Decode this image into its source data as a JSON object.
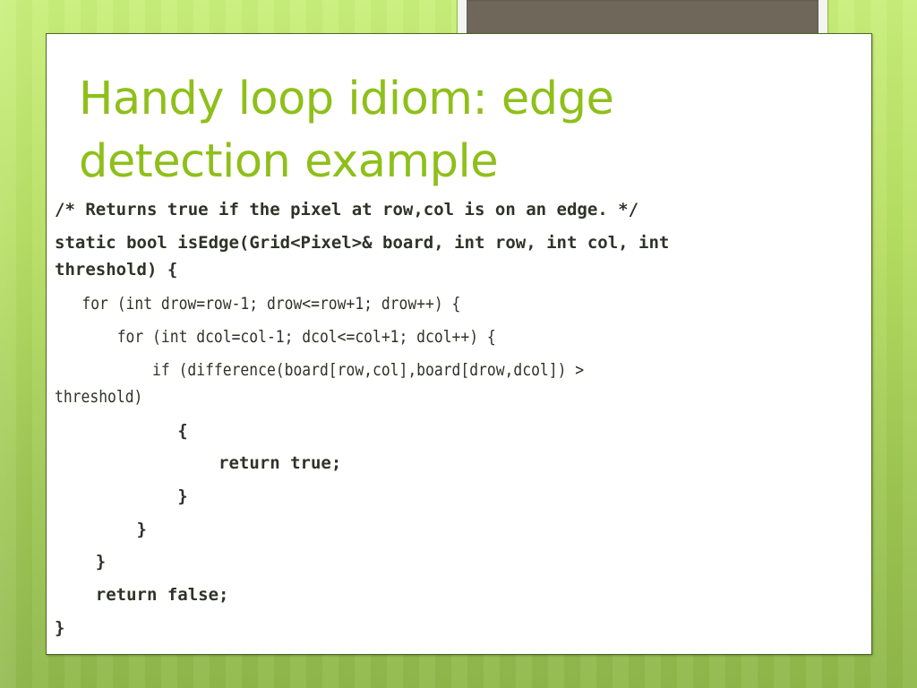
{
  "slide": {
    "title_lines": [
      "Handy loop idiom: edge",
      "detection example"
    ],
    "colors": {
      "title": "#8fbf1a",
      "code_text": "#2f3327",
      "background_green": "#b6de62",
      "photo_placeholder": "#6e675a",
      "frame_border": "#4e6a22"
    },
    "code_lines": [
      "/* Returns true if the pixel at row,col is on an edge. */",
      "static bool isEdge(Grid<Pixel>& board, int row, int col, int",
      "threshold) {",
      "    for (int drow=row-1; drow<=row+1; drow++) {",
      "        for (int dcol=col-1; dcol<=col+1; dcol++) {",
      "            if (difference(board[row,col],board[drow,dcol]) >",
      "threshold)",
      "            {",
      "                return true;",
      "            }",
      "        }",
      "    }",
      "    return false;",
      "}"
    ]
  }
}
